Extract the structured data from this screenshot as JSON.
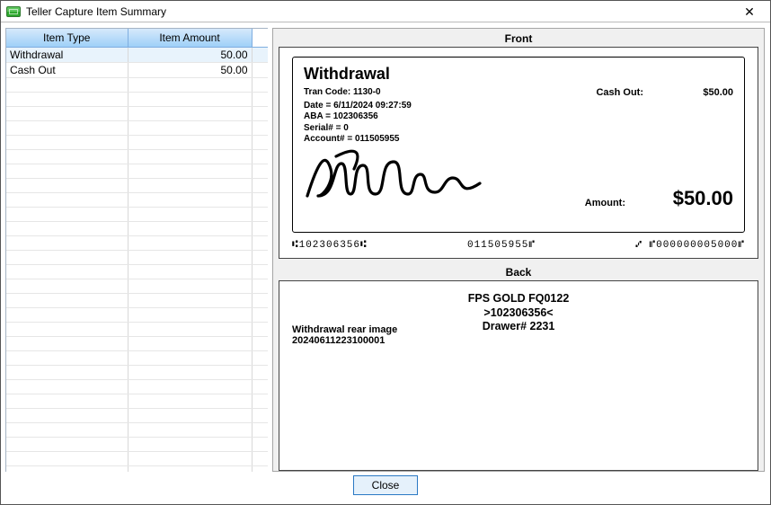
{
  "window": {
    "title": "Teller Capture Item Summary"
  },
  "grid": {
    "headers": {
      "type": "Item Type",
      "amount": "Item Amount"
    },
    "rows": [
      {
        "type": "Withdrawal",
        "amount": "50.00",
        "selected": true
      },
      {
        "type": "Cash Out",
        "amount": "50.00",
        "selected": false
      }
    ],
    "blankRows": 28
  },
  "preview": {
    "frontTitle": "Front",
    "backTitle": "Back",
    "front": {
      "heading": "Withdrawal",
      "tranCode": "Tran Code: 1130-0",
      "cashOutLabel": "Cash Out:",
      "cashOutValue": "$50.00",
      "lines": [
        "Date = 6/11/2024 09:27:59",
        "ABA = 102306356",
        "Serial# = 0",
        "Account# = 011505955"
      ],
      "amountLabel": "Amount:",
      "amountValue": "$50.00",
      "micr": {
        "routing": "⑆102306356⑆",
        "account": "011505955⑈",
        "amount": "⑇ ⑈000000005000⑈"
      }
    },
    "back": {
      "centerLines": [
        "FPS GOLD FQ0122",
        ">102306356<",
        "Drawer# 2231"
      ],
      "leftLines": [
        "Withdrawal rear image",
        "20240611223100001"
      ]
    }
  },
  "buttons": {
    "close": "Close"
  }
}
